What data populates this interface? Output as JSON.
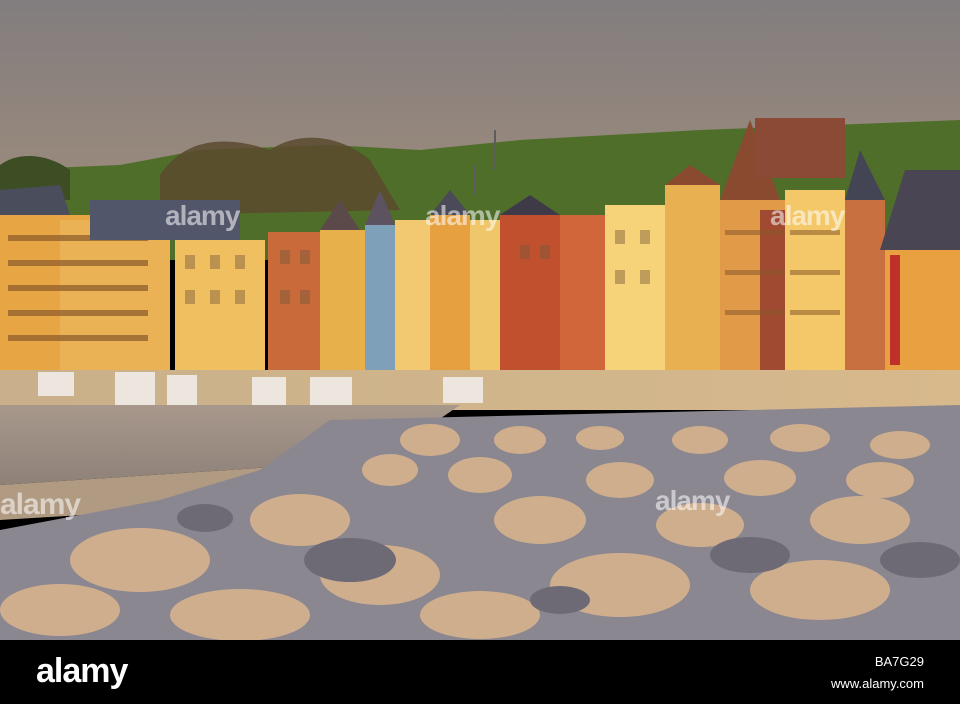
{
  "footer": {
    "logo": "alamy",
    "image_id": "BA7G29",
    "site": "www.alamy.com"
  },
  "watermark": {
    "text": "alamy",
    "marks": [
      "a"
    ]
  },
  "colors": {
    "sky": "#8a7f78",
    "hill": "#4f6e2a",
    "building_warm": "#e8a544",
    "rocks": "#c8a98a",
    "shadow": "#6c6a73"
  }
}
